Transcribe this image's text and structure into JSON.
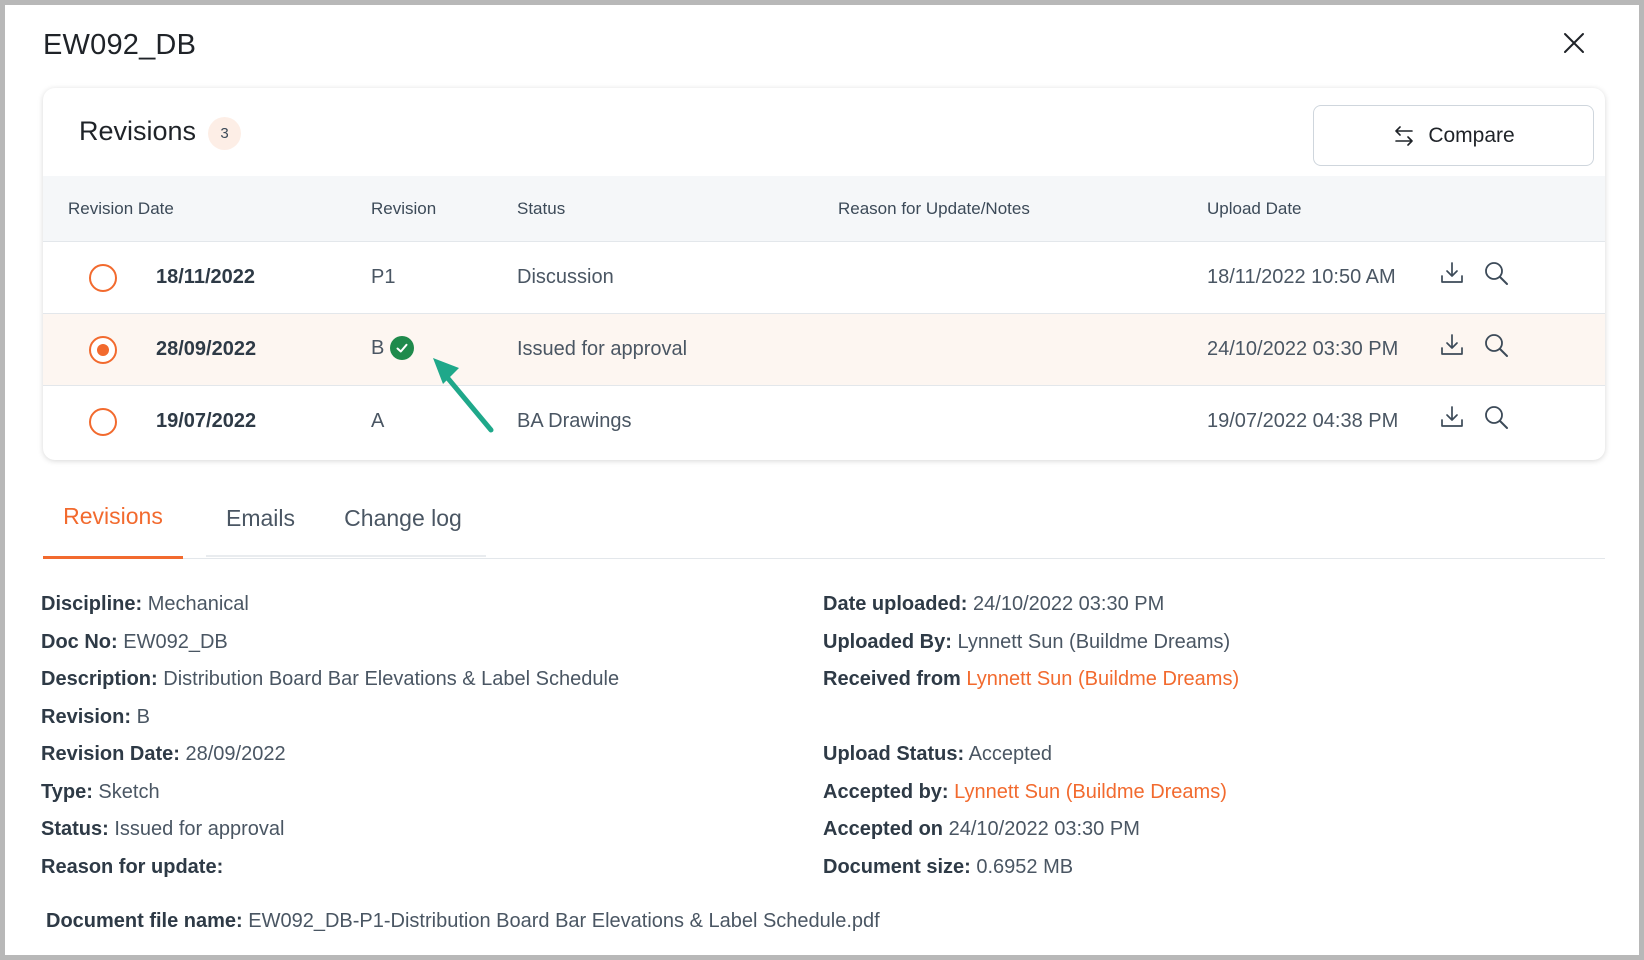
{
  "modal": {
    "title": "EW092_DB"
  },
  "revisions_card": {
    "title": "Revisions",
    "count": "3",
    "compare_label": "Compare",
    "columns": {
      "revision_date": "Revision Date",
      "revision": "Revision",
      "status": "Status",
      "notes": "Reason for Update/Notes",
      "upload_date": "Upload Date"
    },
    "rows": [
      {
        "revision_date": "18/11/2022",
        "revision": "P1",
        "status": "Discussion",
        "notes": "",
        "upload_date": "18/11/2022 10:50 AM",
        "selected": false,
        "accepted": false
      },
      {
        "revision_date": "28/09/2022",
        "revision": "B",
        "status": "Issued for approval",
        "notes": "",
        "upload_date": "24/10/2022 03:30 PM",
        "selected": true,
        "accepted": true
      },
      {
        "revision_date": "19/07/2022",
        "revision": "A",
        "status": "BA Drawings",
        "notes": "",
        "upload_date": "19/07/2022 04:38 PM",
        "selected": false,
        "accepted": false
      }
    ]
  },
  "tabs": [
    {
      "label": "Revisions",
      "active": true
    },
    {
      "label": "Emails",
      "active": false
    },
    {
      "label": "Change log",
      "active": false
    }
  ],
  "details": {
    "left": [
      {
        "label": "Discipline:",
        "value": "Mechanical"
      },
      {
        "label": "Doc No:",
        "value": "EW092_DB"
      },
      {
        "label": "Description:",
        "value": "Distribution Board Bar Elevations & Label Schedule"
      },
      {
        "label": "Revision:",
        "value": "B"
      },
      {
        "label": "Revision Date:",
        "value": "28/09/2022"
      },
      {
        "label": "Type:",
        "value": "Sketch"
      },
      {
        "label": "Status:",
        "value": "Issued for approval"
      },
      {
        "label": "Reason for update:",
        "value": ""
      }
    ],
    "right": [
      {
        "label": "Date uploaded:",
        "value": "24/10/2022 03:30 PM"
      },
      {
        "label": "Uploaded By:",
        "value": "Lynnett Sun (Buildme Dreams)"
      },
      {
        "label": "Received from",
        "value": "Lynnett Sun (Buildme Dreams)"
      },
      {
        "label": "Upload Status:",
        "value": "Accepted"
      },
      {
        "label": "Accepted by:",
        "value": "Lynnett Sun (Buildme Dreams)"
      },
      {
        "label": "Accepted on",
        "value": "24/10/2022 03:30 PM"
      },
      {
        "label": "Document size:",
        "value": "0.6952 MB"
      }
    ],
    "file_name_label": "Document file name:",
    "file_name_value": "EW092_DB-P1-Distribution Board Bar Elevations & Label Schedule.pdf"
  },
  "colors": {
    "accent": "#f26a2e",
    "accepted_green": "#1f8a4c",
    "annotation_arrow": "#1fa88a"
  }
}
